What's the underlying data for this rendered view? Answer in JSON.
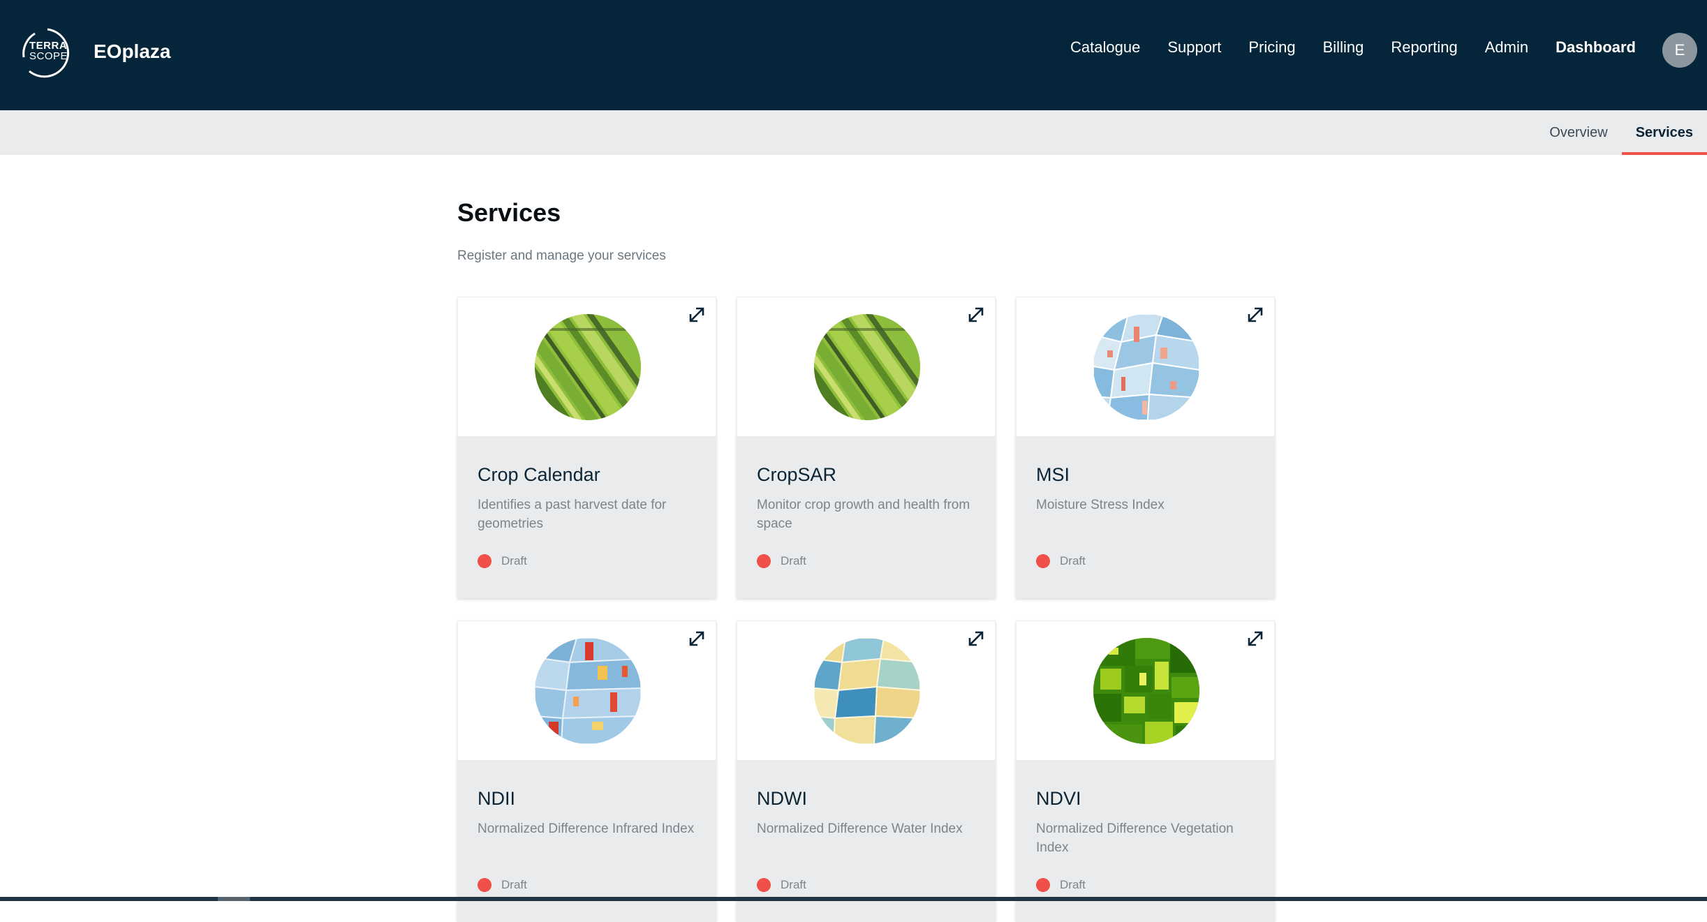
{
  "brand": {
    "logo_line1": "TERRA",
    "logo_line2": "SCOPE",
    "app_name": "EOplaza"
  },
  "nav": {
    "items": [
      "Catalogue",
      "Support",
      "Pricing",
      "Billing",
      "Reporting",
      "Admin",
      "Dashboard"
    ],
    "active": "Dashboard",
    "avatar_initial": "E"
  },
  "subnav": {
    "items": [
      "Overview",
      "Services"
    ],
    "active": "Services"
  },
  "page": {
    "title": "Services",
    "subtitle": "Register and manage your services"
  },
  "services": [
    {
      "title": "Crop Calendar",
      "description": "Identifies a past harvest date for geometries",
      "status": "Draft",
      "thumbnail": "green-fields-aerial-image",
      "expand_icon": "expand-icon"
    },
    {
      "title": "CropSAR",
      "description": "Monitor crop growth and health from space",
      "status": "Draft",
      "thumbnail": "green-fields-aerial-image",
      "expand_icon": "expand-icon"
    },
    {
      "title": "MSI",
      "description": "Moisture Stress Index",
      "status": "Draft",
      "thumbnail": "blue-red-parcel-map-image",
      "expand_icon": "expand-icon"
    },
    {
      "title": "NDII",
      "description": "Normalized Difference Infrared Index",
      "status": "Draft",
      "thumbnail": "blue-red-parcel-map-image",
      "expand_icon": "expand-icon"
    },
    {
      "title": "NDWI",
      "description": "Normalized Difference Water Index",
      "status": "Draft",
      "thumbnail": "yellow-blue-parcel-map-image",
      "expand_icon": "expand-icon"
    },
    {
      "title": "NDVI",
      "description": "Normalized Difference Vegetation Index",
      "status": "Draft",
      "thumbnail": "green-parcel-map-image",
      "expand_icon": "expand-icon"
    }
  ],
  "colors": {
    "header_bg": "#04253a",
    "accent": "#f0504a",
    "subbar_bg": "#eaebed",
    "card_bg": "#eaebed"
  }
}
